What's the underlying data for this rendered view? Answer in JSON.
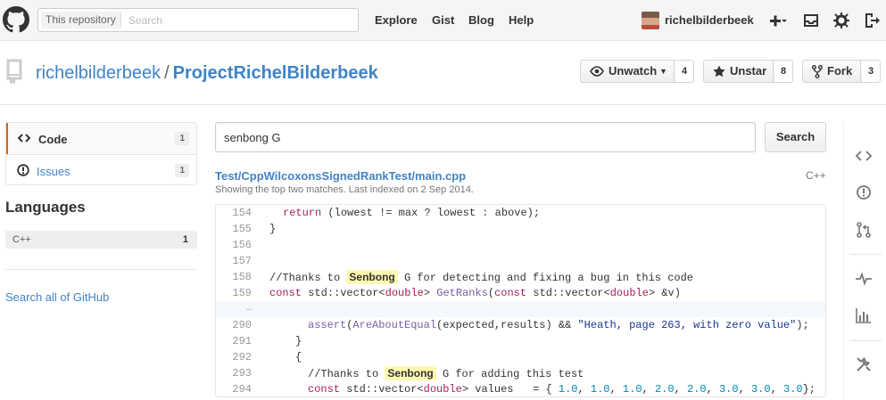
{
  "header": {
    "scope_label": "This repository",
    "search_placeholder": "Search",
    "nav": [
      "Explore",
      "Gist",
      "Blog",
      "Help"
    ],
    "username": "richelbilderbeek",
    "icons": [
      "octocat-logo",
      "plus-icon",
      "inbox-icon",
      "gear-icon",
      "sign-out-icon"
    ]
  },
  "repo": {
    "owner": "richelbilderbeek",
    "separator": "/",
    "name": "ProjectRichelBilderbeek",
    "watch": {
      "label": "Unwatch",
      "count": "4"
    },
    "star": {
      "label": "Unstar",
      "count": "8"
    },
    "fork": {
      "label": "Fork",
      "count": "3"
    }
  },
  "sidebar": {
    "items": [
      {
        "label": "Code",
        "count": "1",
        "active": true
      },
      {
        "label": "Issues",
        "count": "1",
        "active": false
      }
    ],
    "languages_heading": "Languages",
    "languages": [
      {
        "name": "C++",
        "count": "1"
      }
    ],
    "search_all": "Search all of GitHub"
  },
  "search": {
    "query": "senbong G",
    "button": "Search"
  },
  "result": {
    "path": "Test/CppWilcoxonsSignedRankTest/main.cpp",
    "language": "C++",
    "meta": "Showing the top two matches. Last indexed on 2 Sep 2014.",
    "line_numbers": [
      "154",
      "155",
      "156",
      "157",
      "158",
      "159",
      "…",
      "290",
      "291",
      "292",
      "293",
      "294"
    ],
    "lines": {
      "l154": {
        "kw": "return",
        "rest": " (lowest != max ? lowest : above);"
      },
      "l155": "}",
      "l158": {
        "pre": "//Thanks to ",
        "match": "Senbong",
        "post": " G for detecting and fixing a bug in this code"
      },
      "l159": {
        "kw1": "const",
        "a": " std::vector<",
        "ty": "double",
        "b": "> ",
        "fn": "GetRanks",
        "c": "(",
        "kw2": "const",
        "d": " std::vector<",
        "ty2": "double",
        "e": "> &v)"
      },
      "l290": {
        "fn1": "assert",
        "a": "(",
        "fn2": "AreAboutEqual",
        "b": "(expected,results) && ",
        "str": "\"Heath, page 263, with zero value\"",
        "c": ");"
      },
      "l291": "}",
      "l292": "{",
      "l293": {
        "pre": "//Thanks to ",
        "match": "Senbong",
        "post": " G for adding this test"
      },
      "l294": {
        "kw": "const",
        "a": " std::vector<",
        "ty": "double",
        "b": "> values   = { ",
        "nums": [
          "1.0",
          "1.0",
          "1.0",
          "2.0",
          "2.0",
          "3.0",
          "3.0",
          "3.0"
        ],
        "c": "};"
      }
    }
  },
  "rail_icons": [
    "code-icon",
    "issue-icon",
    "pull-request-icon",
    "pulse-icon",
    "graph-icon",
    "settings-icon"
  ]
}
